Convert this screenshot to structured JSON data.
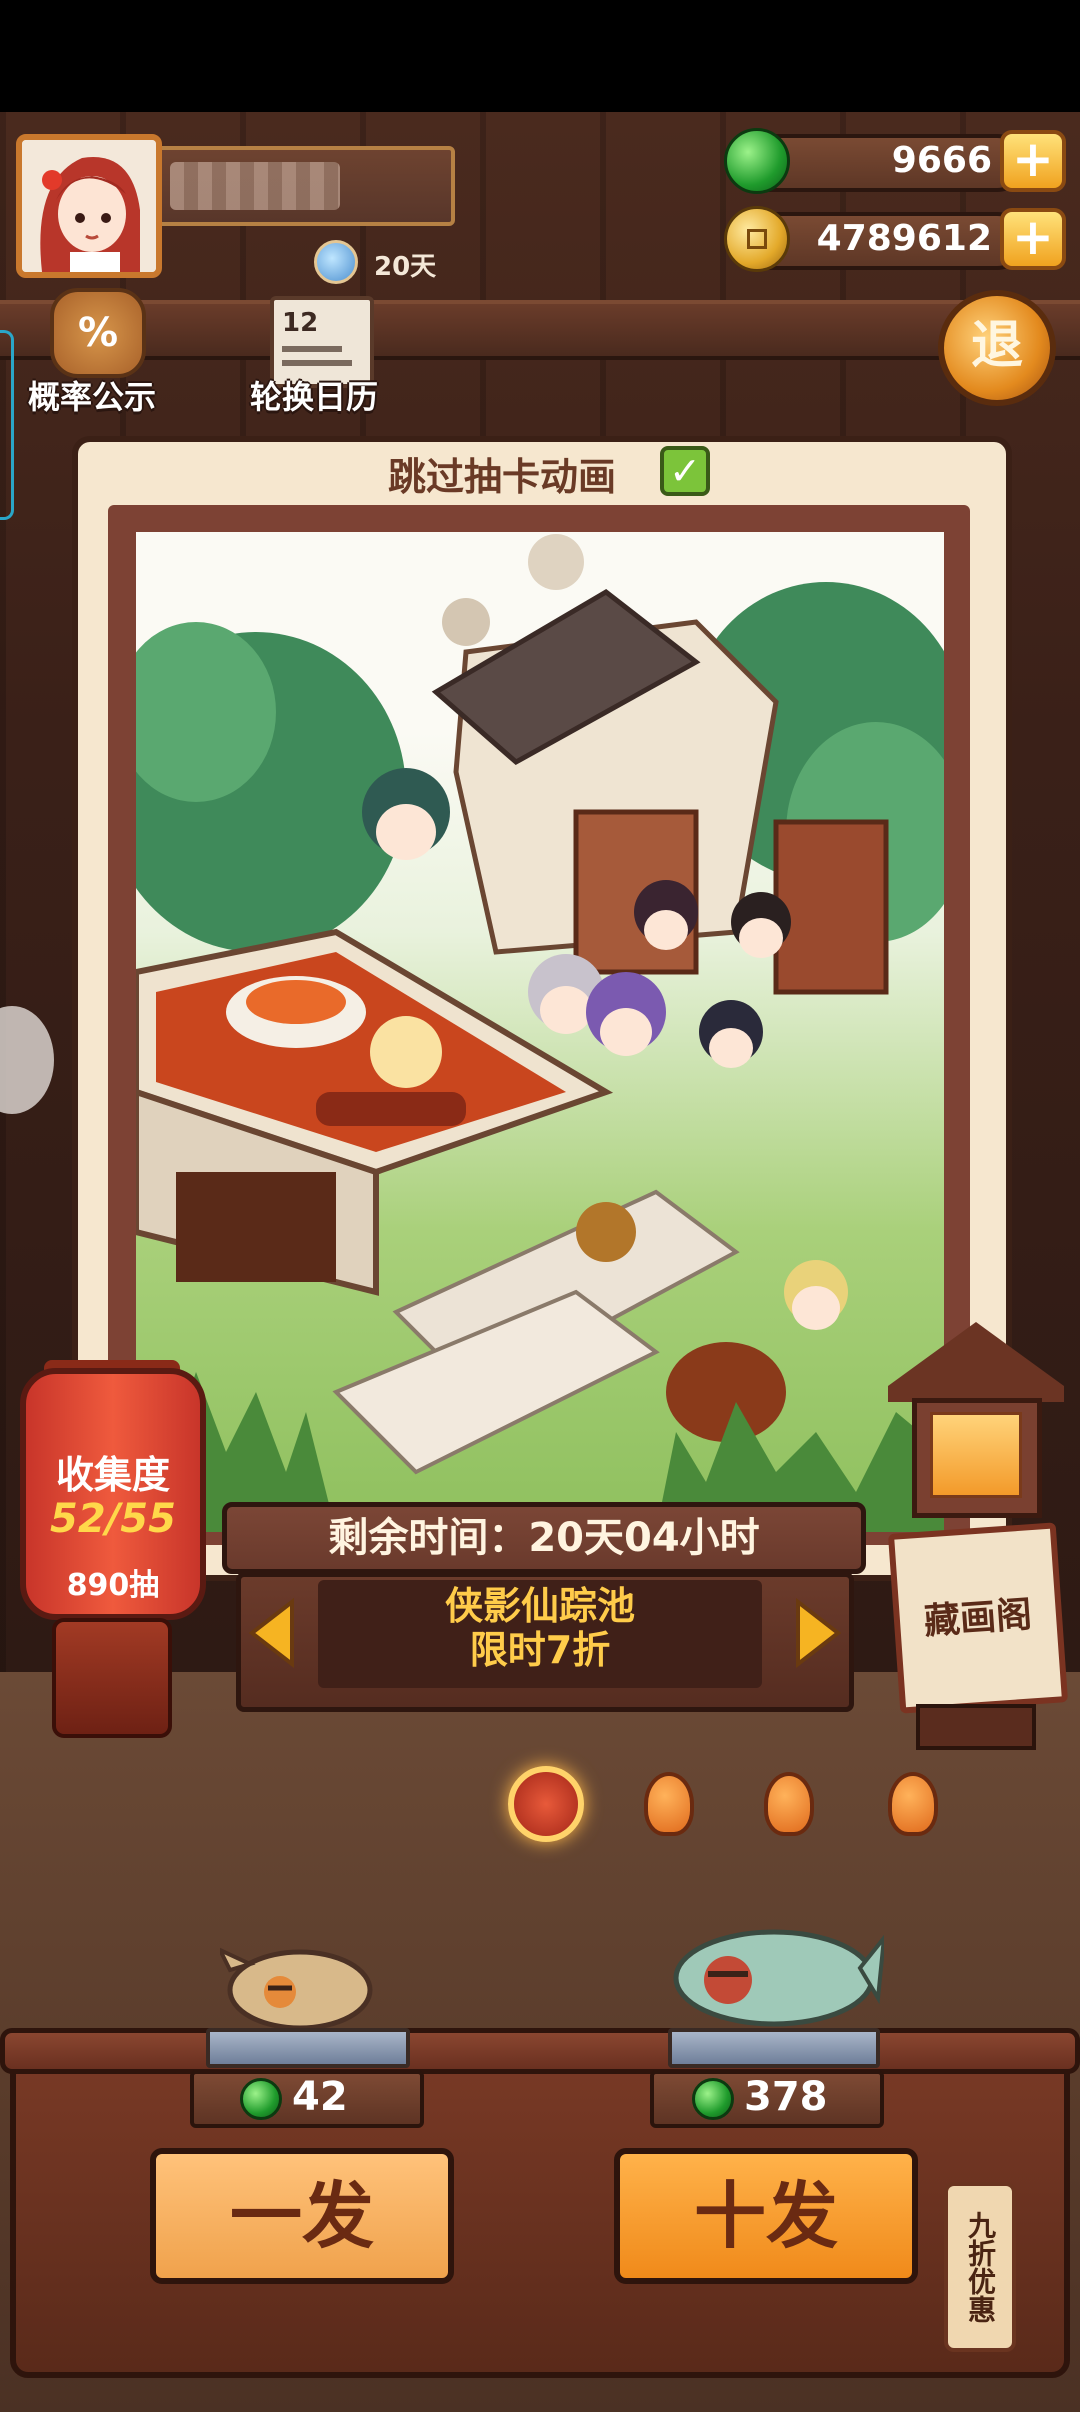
{
  "player": {
    "days": "20天"
  },
  "currency": {
    "jade": "9666",
    "coins": "4789612"
  },
  "top_icons": {
    "probability_label": "概率公示",
    "probability_symbol": "%",
    "calendar_label": "轮换日历",
    "calendar_number": "12",
    "exit_label": "退"
  },
  "card": {
    "skip_animation_label": "跳过抽卡动画",
    "skip_checked": true
  },
  "pool": {
    "remaining_time": "剩余时间：20天04小时",
    "name_line1": "侠影仙踪池",
    "name_line2": "限时7折",
    "page_count": 4,
    "active_page": 1
  },
  "collection": {
    "label": "收集度",
    "progress": "52/55",
    "draws": "890抽"
  },
  "gallery": {
    "label": "藏画阁"
  },
  "draws": {
    "single_cost": "42",
    "single_label": "一发",
    "ten_cost": "378",
    "ten_label": "十发",
    "discount_tag": "九折优惠"
  },
  "colors": {
    "accent_orange": "#f0a21f",
    "jade_green": "#1f9b2c",
    "pool_text": "#ffcc4a",
    "progress_text": "#ffd84a"
  }
}
